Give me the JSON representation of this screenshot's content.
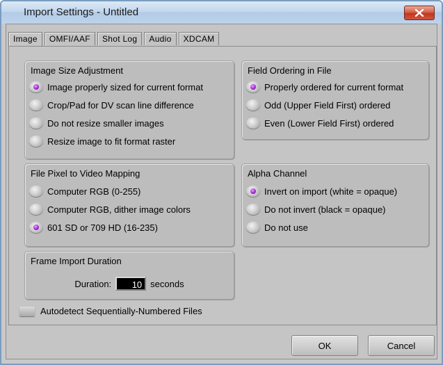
{
  "window": {
    "title": "Import Settings - Untitled"
  },
  "tabs": [
    {
      "label": "Image",
      "active": true
    },
    {
      "label": "OMFI/AAF",
      "active": false
    },
    {
      "label": "Shot Log",
      "active": false
    },
    {
      "label": "Audio",
      "active": false
    },
    {
      "label": "XDCAM",
      "active": false
    }
  ],
  "image_size": {
    "title": "Image Size Adjustment",
    "options": [
      {
        "label": "Image properly sized for current format",
        "selected": true
      },
      {
        "label": "Crop/Pad for DV scan line difference",
        "selected": false
      },
      {
        "label": "Do not resize smaller images",
        "selected": false
      },
      {
        "label": "Resize image to fit format raster",
        "selected": false
      }
    ]
  },
  "field_ordering": {
    "title": "Field Ordering in File",
    "options": [
      {
        "label": "Properly ordered for current format",
        "selected": true
      },
      {
        "label": "Odd (Upper Field First) ordered",
        "selected": false
      },
      {
        "label": "Even (Lower Field First) ordered",
        "selected": false
      }
    ]
  },
  "pixel_mapping": {
    "title": "File Pixel to Video Mapping",
    "options": [
      {
        "label": "Computer RGB (0-255)",
        "selected": false
      },
      {
        "label": "Computer RGB, dither image colors",
        "selected": false
      },
      {
        "label": "601 SD or 709 HD (16-235)",
        "selected": true
      }
    ]
  },
  "alpha_channel": {
    "title": "Alpha Channel",
    "options": [
      {
        "label": "Invert on import (white = opaque)",
        "selected": true
      },
      {
        "label": "Do not invert (black = opaque)",
        "selected": false
      },
      {
        "label": "Do not use",
        "selected": false
      }
    ]
  },
  "frame_import": {
    "title": "Frame Import Duration",
    "duration_label": "Duration:",
    "duration_value": "10",
    "units": "seconds"
  },
  "autodetect": {
    "label": "Autodetect Sequentially-Numbered Files",
    "checked": false
  },
  "buttons": {
    "ok": "OK",
    "cancel": "Cancel"
  },
  "icons": {
    "close": "close-icon",
    "radio": "radio-icon",
    "checkbox": "checkbox-icon"
  },
  "colors": {
    "radio_selected": "#a02ad0",
    "close_button": "#c2371f",
    "titlebar": "#c3d7ee"
  }
}
